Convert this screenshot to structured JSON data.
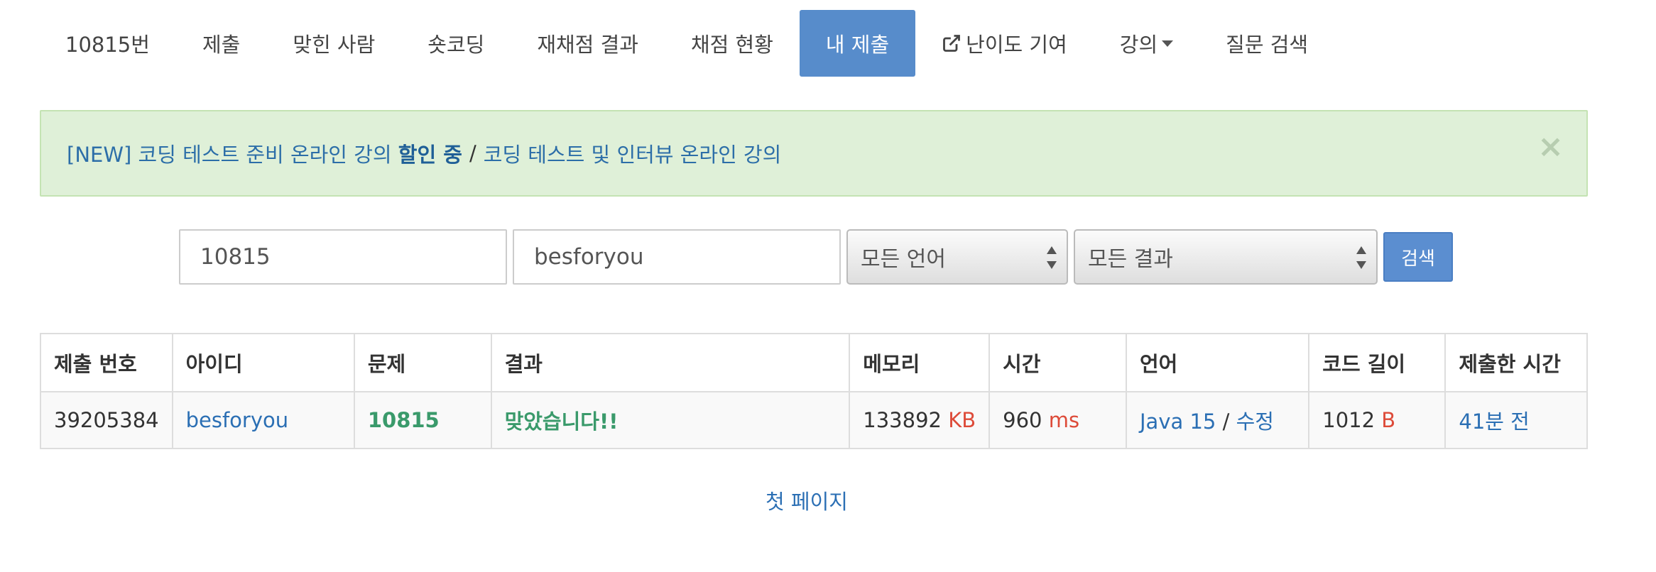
{
  "nav": {
    "tabs": [
      {
        "label": "10815번",
        "active": false
      },
      {
        "label": "제출",
        "active": false
      },
      {
        "label": "맞힌 사람",
        "active": false
      },
      {
        "label": "숏코딩",
        "active": false
      },
      {
        "label": "재채점 결과",
        "active": false
      },
      {
        "label": "채점 현황",
        "active": false
      },
      {
        "label": "내 제출",
        "active": true
      },
      {
        "label": "난이도 기여",
        "active": false,
        "icon": "external-link-icon"
      },
      {
        "label": "강의",
        "active": false,
        "icon": "caret-down-icon"
      },
      {
        "label": "질문 검색",
        "active": false
      }
    ],
    "active_color": "#578ccb"
  },
  "alert": {
    "link1_prefix": "[NEW] 코딩 테스트 준비 온라인 강의 ",
    "link1_bold": "할인 중",
    "separator": "/",
    "link2": "코딩 테스트 및 인터뷰 온라인 강의",
    "close_label": "×",
    "background": "#dff0d8"
  },
  "search": {
    "problem_id": "10815",
    "user_id": "besforyou",
    "language_selected": "모든 언어",
    "result_selected": "모든 결과",
    "button_label": "검색"
  },
  "table": {
    "headers": [
      "제출 번호",
      "아이디",
      "문제",
      "결과",
      "메모리",
      "시간",
      "언어",
      "코드 길이",
      "제출한 시간"
    ],
    "rows": [
      {
        "submission_id": "39205384",
        "user": "besforyou",
        "problem": "10815",
        "result": "맞았습니다!!",
        "memory": "133892",
        "memory_unit": "KB",
        "time": "960",
        "time_unit": "ms",
        "language": "Java 15",
        "lang_sep": "/",
        "edit_label": "수정",
        "code_length": "1012",
        "code_length_unit": "B",
        "submitted": "41분 전"
      }
    ]
  },
  "pagination": {
    "first_page_label": "첫 페이지"
  }
}
